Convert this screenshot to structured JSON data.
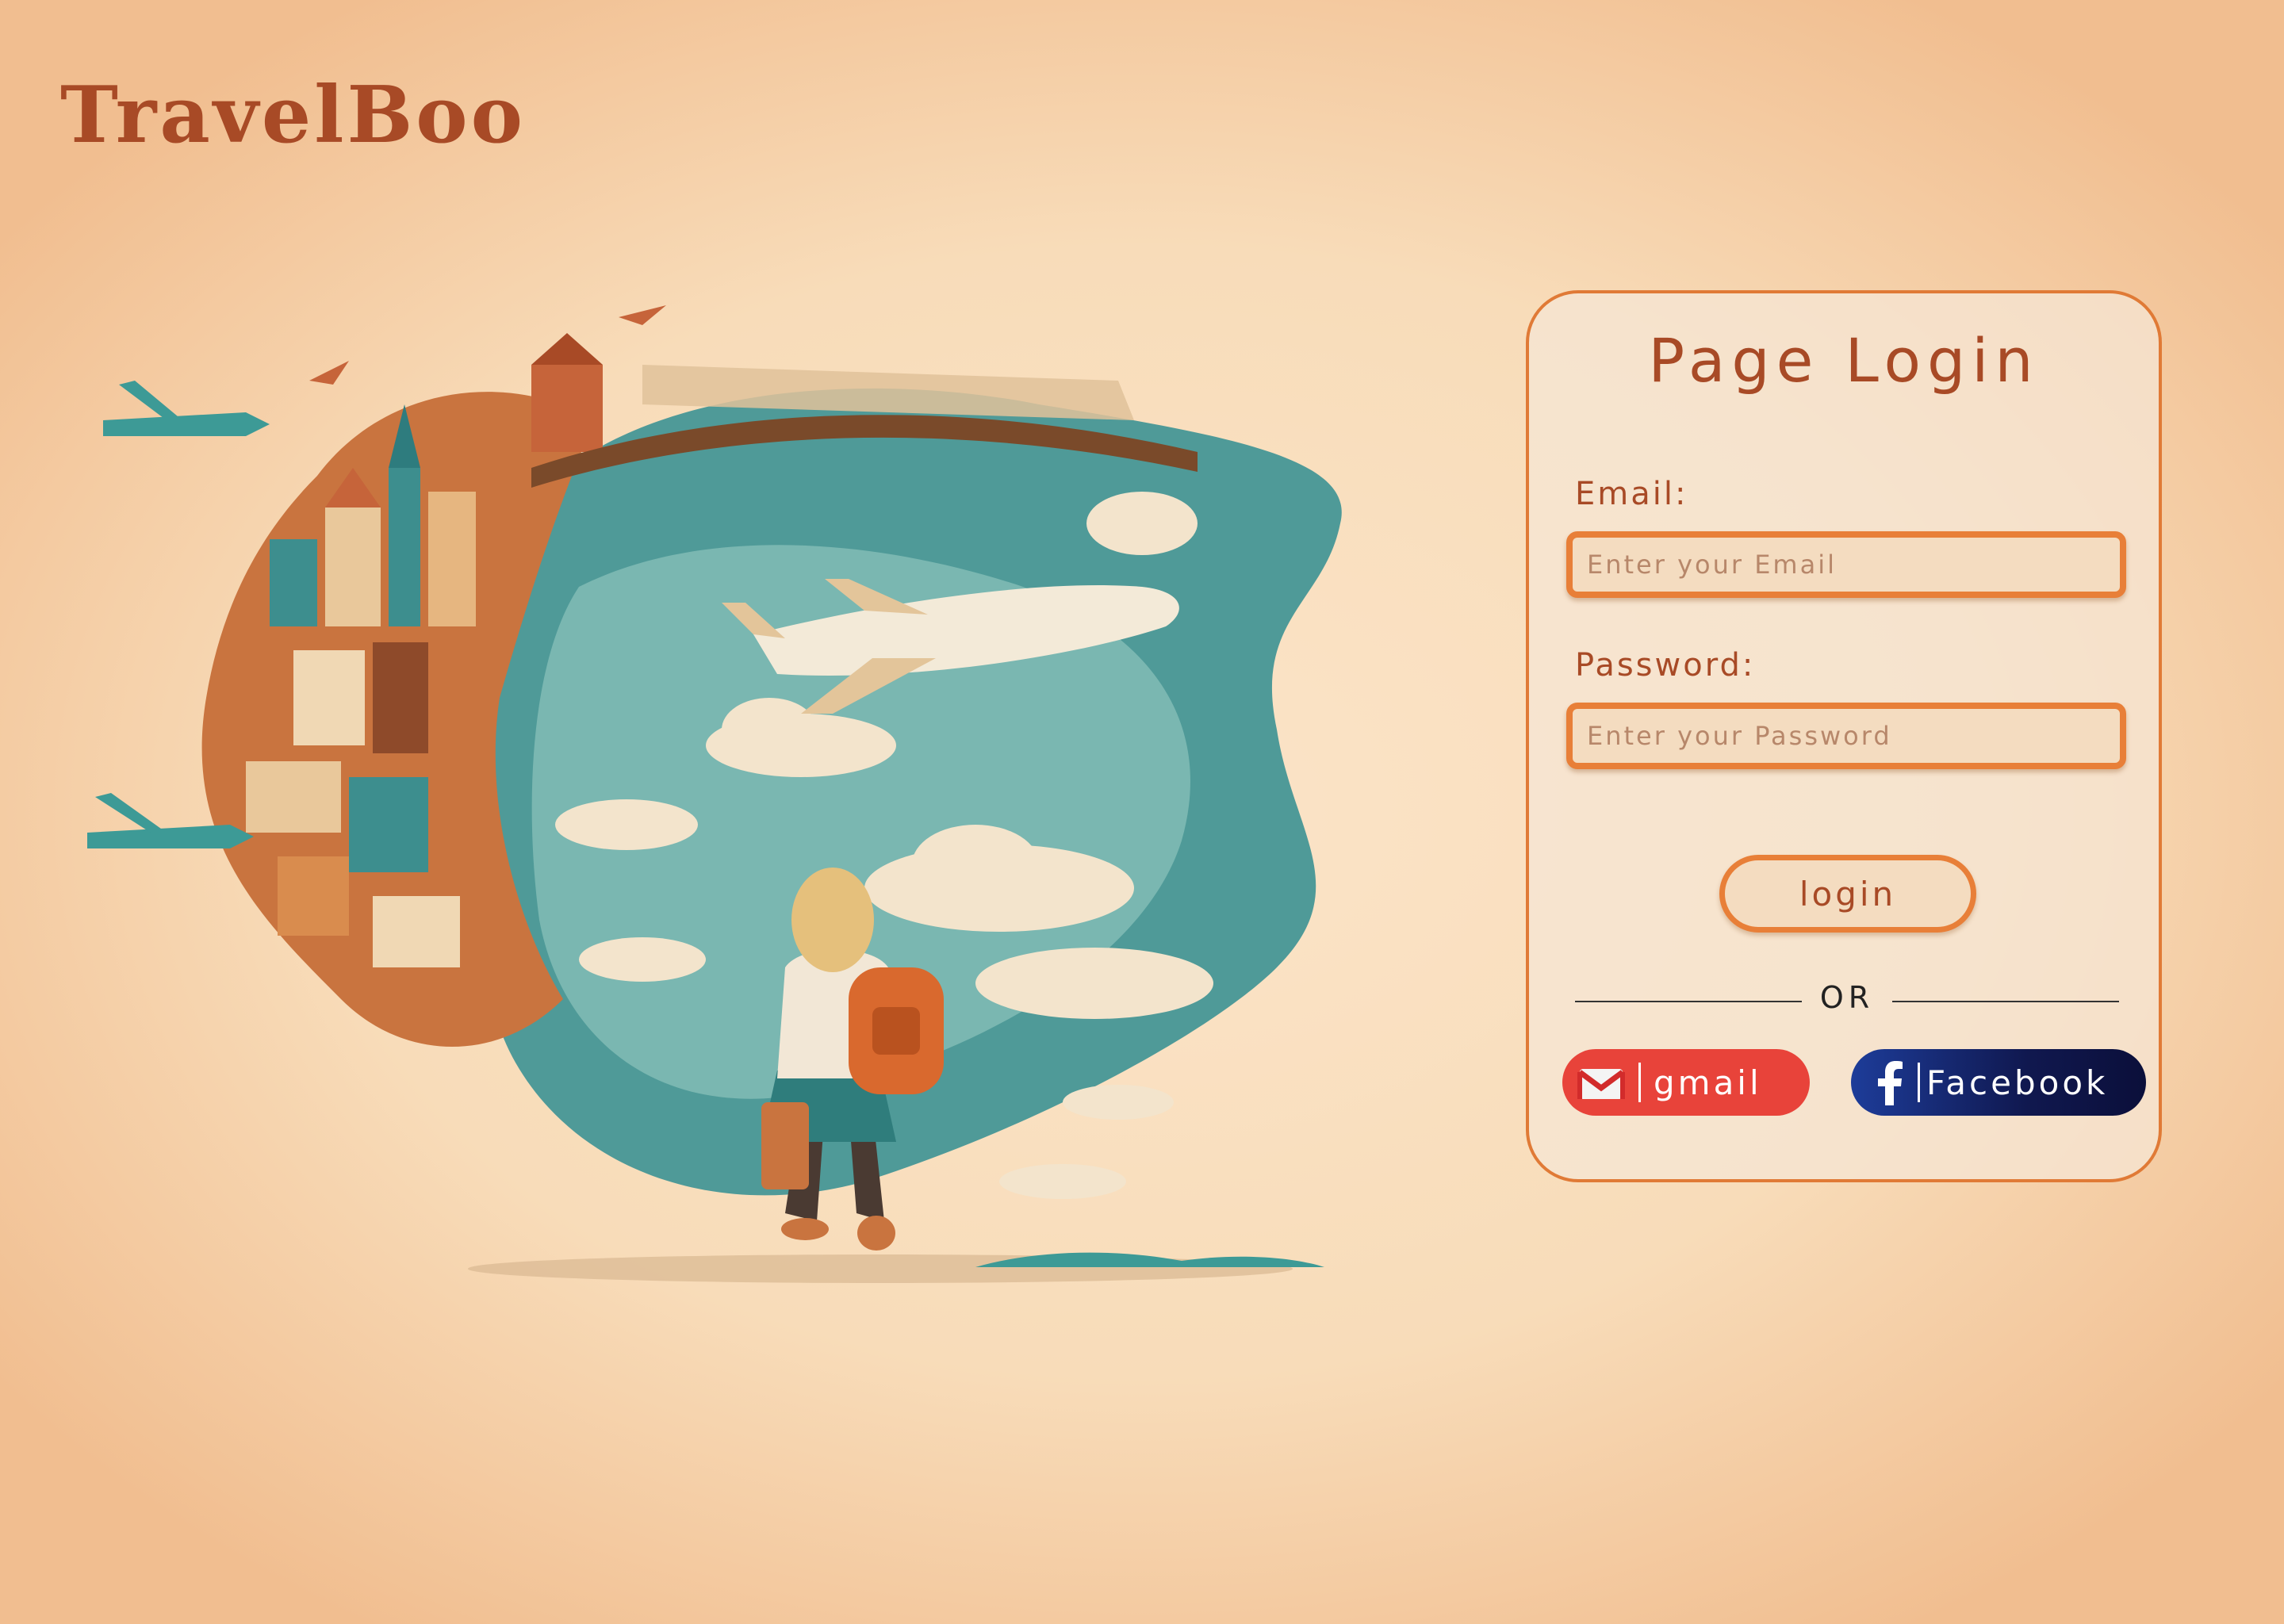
{
  "brand": {
    "name": "TravelBoo"
  },
  "hero": {
    "image_description_icon": "travel-illustration"
  },
  "login_card": {
    "title": "Page Login",
    "email_label": "Email:",
    "email_placeholder": "Enter your Email",
    "password_label": "Password:",
    "password_placeholder": "Enter your Password",
    "login_button": "login",
    "divider_text": "OR",
    "gmail_button": "gmail",
    "facebook_button": "Facebook"
  },
  "colors": {
    "accent": "#e87f38",
    "brand_text": "#a84a26",
    "gmail_red": "#e8433a",
    "facebook_navy": "#10184f"
  }
}
